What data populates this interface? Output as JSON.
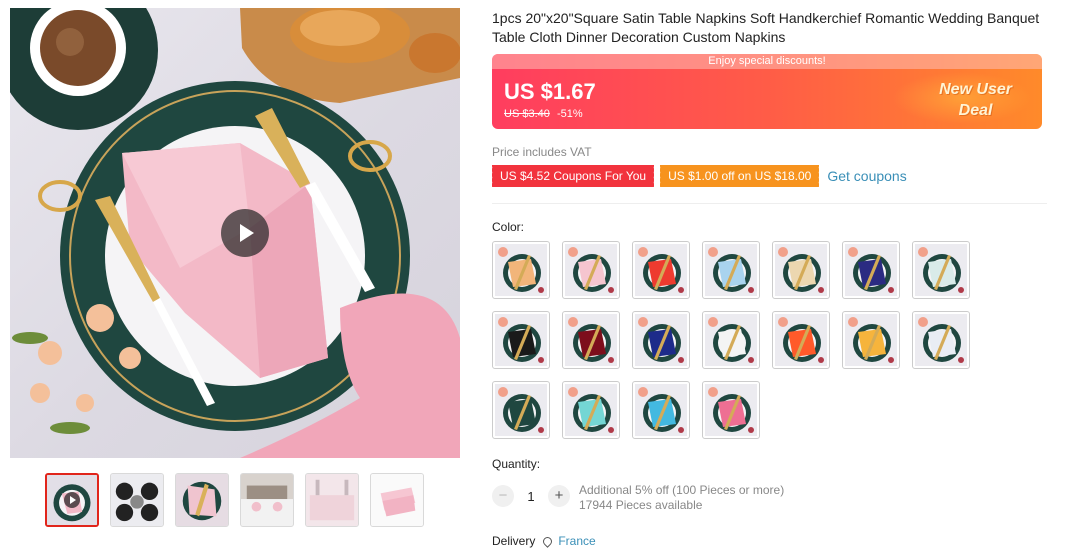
{
  "product": {
    "title": "1pcs 20\"x20\"Square Satin Table Napkins Soft Handkerchief Romantic Wedding Banquet Table Cloth Dinner Decoration Custom Napkins"
  },
  "gallery": {
    "play_icon": "play-icon",
    "thumbnails": [
      {
        "name": "thumb-1",
        "tone": "#f3b9c7",
        "active": true
      },
      {
        "name": "thumb-2",
        "tone": "#e9e9ee",
        "active": false
      },
      {
        "name": "thumb-3",
        "tone": "#f0c4cf",
        "active": false
      },
      {
        "name": "thumb-4",
        "tone": "#dfdad6",
        "active": false
      },
      {
        "name": "thumb-5",
        "tone": "#efd3da",
        "active": false
      },
      {
        "name": "thumb-6",
        "tone": "#f6c6d2",
        "active": false
      }
    ]
  },
  "price": {
    "banner_strip": "Enjoy special discounts!",
    "current": "US $1.67",
    "original": "US $3.40",
    "discount": "-51%",
    "deal_line1": "New User",
    "deal_line2": "Deal",
    "vat_note": "Price includes VAT"
  },
  "coupons": {
    "coupon1": "US $4.52 Coupons For You",
    "coupon2": "US $1.00 off on US $18.00",
    "get_coupons": "Get coupons"
  },
  "color": {
    "label": "Color:",
    "swatches": [
      "#f2b57a",
      "#f5c5cf",
      "#ee3b2f",
      "#a9d3ee",
      "#ecd7b0",
      "#2b2b82",
      "#d9ebe9",
      "#1a1a1a",
      "#7d0e1c",
      "#1d2b8a",
      "#f4f4f4",
      "#ff5a2a",
      "#f6b43c",
      "#e9edf4",
      "#1f4740",
      "#74d6d4",
      "#43b9e0",
      "#ee6f93"
    ]
  },
  "quantity": {
    "label": "Quantity:",
    "value": "1",
    "minus": "−",
    "plus": "+",
    "note1": "Additional 5% off (100 Pieces or more)",
    "note2": "17944 Pieces available"
  },
  "delivery": {
    "label": "Delivery",
    "icon": "location-pin-icon",
    "country": "France"
  }
}
